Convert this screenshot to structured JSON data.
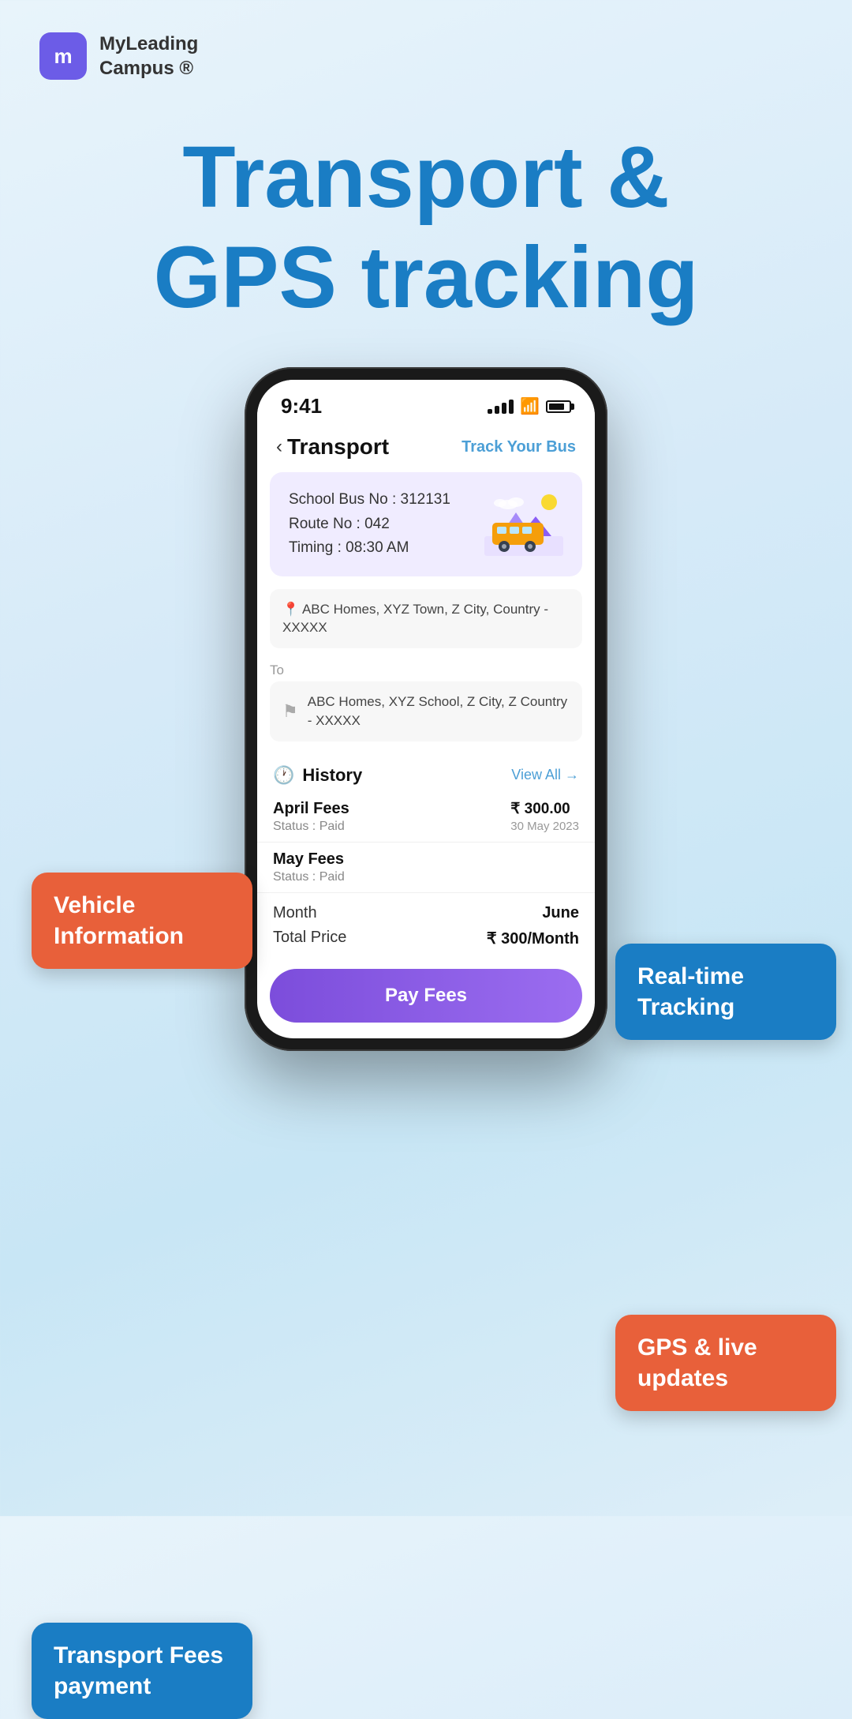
{
  "brand": {
    "logo_letter": "m",
    "name_line1": "MyLeading",
    "name_line2": "Campus ®"
  },
  "hero": {
    "title_line1": "Transport &",
    "title_line2": "GPS tracking"
  },
  "phone": {
    "status_bar": {
      "time": "9:41",
      "signal": "all",
      "wifi": "wifi",
      "battery": "battery"
    },
    "app_header": {
      "back_label": "Transport",
      "track_link": "Track Your Bus"
    },
    "bus_card": {
      "bus_no_label": "School Bus No : ",
      "bus_no": "312131",
      "route_label": "Route No : ",
      "route_no": "042",
      "timing_label": "Timing : ",
      "timing": "08:30 AM"
    },
    "from": {
      "address": "ABC Homes, XYZ Town, Z City, Country - XXXXX"
    },
    "to": {
      "label": "To",
      "address": "ABC Homes, XYZ School, Z City, Z Country - XXXXX"
    },
    "history": {
      "title": "History",
      "view_all": "View All →",
      "items": [
        {
          "name": "April Fees",
          "status": "Status : Paid",
          "amount": "₹ 300.00",
          "date": "30 May 2023"
        },
        {
          "name": "May Fees",
          "status": "Status : Paid",
          "amount": "",
          "date": ""
        }
      ]
    },
    "summary": {
      "month_label": "Month",
      "month_value": "June",
      "total_label": "Total Price",
      "total_value": "₹ 300/Month"
    },
    "pay_button": "Pay Fees"
  },
  "bubbles": {
    "vehicle_info": "Vehicle\nInformation",
    "realtime": "Real-time\nTracking",
    "gps": "GPS & live\nupdates",
    "transport": "Transport\nFees payment"
  }
}
